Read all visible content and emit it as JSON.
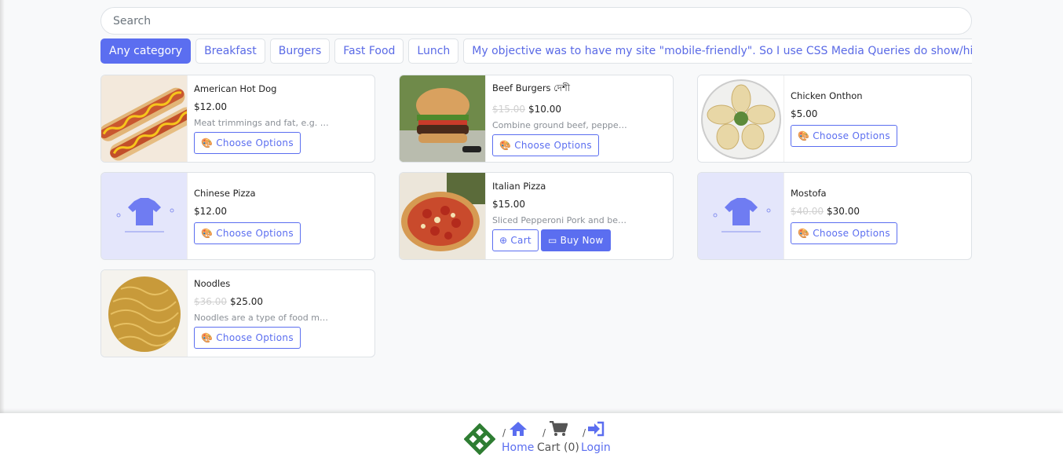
{
  "search": {
    "placeholder": "Search"
  },
  "categories": [
    {
      "label": "Any category",
      "active": true
    },
    {
      "label": "Breakfast"
    },
    {
      "label": "Burgers"
    },
    {
      "label": "Fast Food"
    },
    {
      "label": "Lunch"
    },
    {
      "label": "My objective was to have my site \"mobile-friendly\". So I use CSS Media Queries do show/hide elements depending on the screen size"
    }
  ],
  "products": [
    {
      "name": "American Hot Dog",
      "price": "$12.00",
      "description": "Meat trimmings and fat, e.g. m...",
      "button": "Choose Options"
    },
    {
      "name": "Beef Burgers দেশী",
      "old_price": "$15.00",
      "price": "$10.00",
      "description": "Combine ground beef, pepper, s...",
      "button": "Choose Options"
    },
    {
      "name": "Chicken Onthon",
      "price": "$5.00",
      "button": "Choose Options"
    },
    {
      "name": "Chinese Pizza",
      "price": "$12.00",
      "button": "Choose Options"
    },
    {
      "name": "Italian Pizza",
      "price": "$15.00",
      "description": "Sliced Pepperoni Pork and beef...",
      "button": "Cart",
      "button2": "Buy Now"
    },
    {
      "name": "Mostofa",
      "old_price": "$40.00",
      "price": "$30.00",
      "button": "Choose Options"
    },
    {
      "name": "Noodles",
      "old_price": "$36.00",
      "price": "$25.00",
      "description": "Noodles are a type of food mad...",
      "button": "Choose Options"
    }
  ],
  "footer": {
    "sep": "/",
    "home": "Home",
    "cart": "Cart (0)",
    "login": "Login"
  },
  "colors": {
    "accent": "#5b6ef0",
    "placeholder_bg": "#e4e6fb"
  }
}
